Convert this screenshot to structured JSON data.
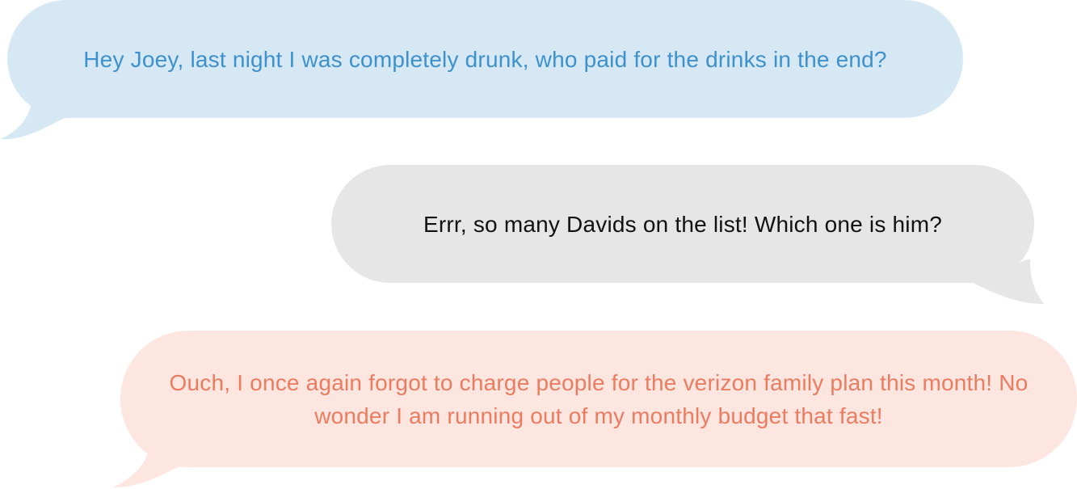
{
  "messages": [
    {
      "text": "Hey Joey, last night I was completely drunk, who paid for the drinks in the end?",
      "side": "left",
      "bubble_color": "#d7e8f5",
      "text_color": "#3d91cc"
    },
    {
      "text": "Errr, so many Davids on the list! Which one is him?",
      "side": "right",
      "bubble_color": "#e6e6e6",
      "text_color": "#111111"
    },
    {
      "text": "Ouch, I once again forgot to charge people for the verizon family plan this month! No wonder I am running out of my monthly budget that fast!",
      "side": "left",
      "bubble_color": "#fde6e0",
      "text_color": "#ec7c60"
    }
  ]
}
